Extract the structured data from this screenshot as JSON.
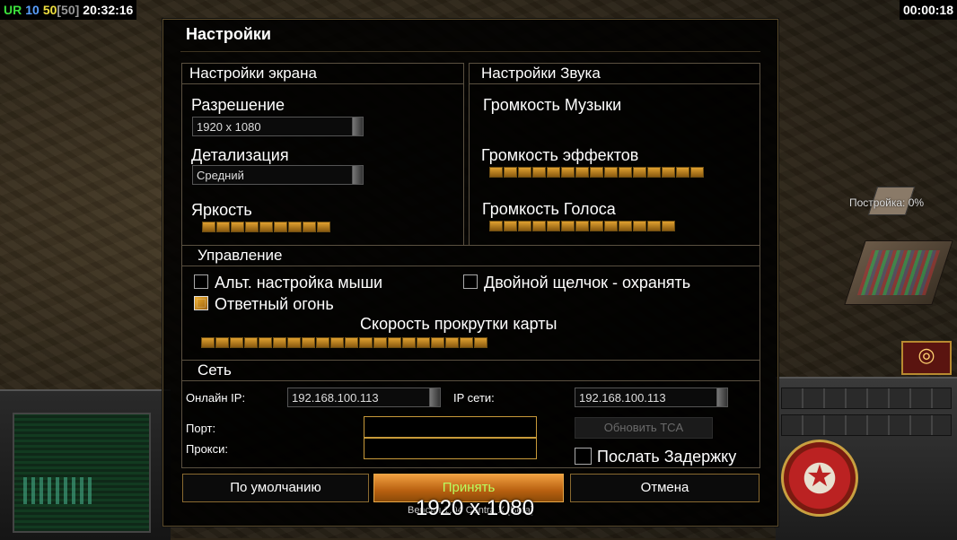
{
  "hud": {
    "ur": "UR",
    "num1": "10",
    "num2": "50",
    "num3": "[50]",
    "clock": "20:32:16",
    "timer": "00:00:18"
  },
  "world": {
    "build_progress": "Постройка: 0%"
  },
  "dialog": {
    "title": "Настройки",
    "screen": {
      "heading": "Настройки экрана",
      "resolution_label": "Разрешение",
      "resolution_value": "1920 x 1080",
      "detail_label": "Детализация",
      "detail_value": "Средний",
      "brightness_label": "Яркость",
      "brightness_level": 9
    },
    "sound": {
      "heading": "Настройки Звука",
      "music_label": "Громкость Музыки",
      "effects_label": "Громкость эффектов",
      "effects_level": 15,
      "voice_label": "Громкость Голоса",
      "voice_level": 13
    },
    "control": {
      "heading": "Управление",
      "alt_mouse_label": "Альт. настройка мыши",
      "alt_mouse_checked": false,
      "double_click_label": "Двойной щелчок - охранять",
      "double_click_checked": false,
      "return_fire_label": "Ответный огонь",
      "return_fire_checked": true,
      "scroll_speed_label": "Скорость прокрутки карты",
      "scroll_speed_level": 20
    },
    "network": {
      "heading": "Сеть",
      "online_ip_label": "Онлайн IP:",
      "online_ip_value": "192.168.100.113",
      "lan_ip_label": "IP сети:",
      "lan_ip_value": "192.168.100.113",
      "port_label": "Порт:",
      "port_value": "",
      "proxy_label": "Прокси:",
      "proxy_value": "",
      "update_tca_label": "Обновить TCA",
      "send_delay_label": "Послать Задержку",
      "send_delay_checked": false
    },
    "buttons": {
      "defaults": "По умолчанию",
      "accept": "Принять",
      "cancel": "Отмена"
    },
    "version_text": "Версия 1.04 Contra X [Beta]",
    "overlay_resolution": "1920 x 1080"
  },
  "colors": {
    "accent": "#e8a848",
    "slider_fill": "#d89028",
    "accept_text": "#b8ff60"
  }
}
